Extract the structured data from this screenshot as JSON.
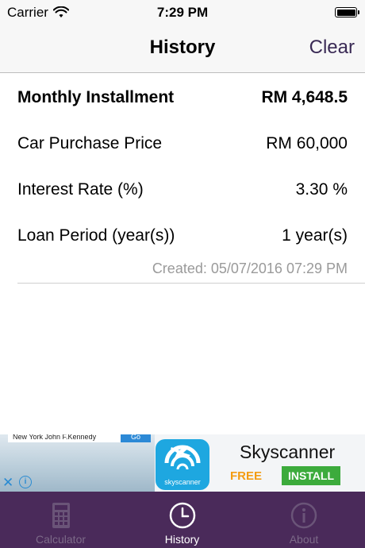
{
  "status_bar": {
    "carrier": "Carrier",
    "time": "7:29 PM"
  },
  "nav": {
    "title": "History",
    "clear_label": "Clear"
  },
  "record": {
    "installment_label": "Monthly Installment",
    "installment_value": "RM 4,648.5",
    "price_label": "Car Purchase Price",
    "price_value": "RM 60,000",
    "rate_label": "Interest Rate (%)",
    "rate_value": "3.30 %",
    "period_label": "Loan Period (year(s))",
    "period_value": "1 year(s)",
    "created": "Created: 05/07/2016 07:29 PM"
  },
  "ad": {
    "search_text": "New York John F.Kennedy",
    "go_label": "Go",
    "logo_text": "skyscanner",
    "brand": "Skyscanner",
    "free_label": "FREE",
    "install_label": "INSTALL",
    "close_icon": "close-icon",
    "info_icon": "info-icon"
  },
  "tabs": [
    {
      "label": "Calculator",
      "icon": "calculator-icon",
      "active": false
    },
    {
      "label": "History",
      "icon": "clock-icon",
      "active": true
    },
    {
      "label": "About",
      "icon": "info-icon",
      "active": false
    }
  ],
  "colors": {
    "tab_bar": "#4a2a5a",
    "accent": "#3a2a55",
    "install": "#3cab3c",
    "free": "#f39c12"
  }
}
